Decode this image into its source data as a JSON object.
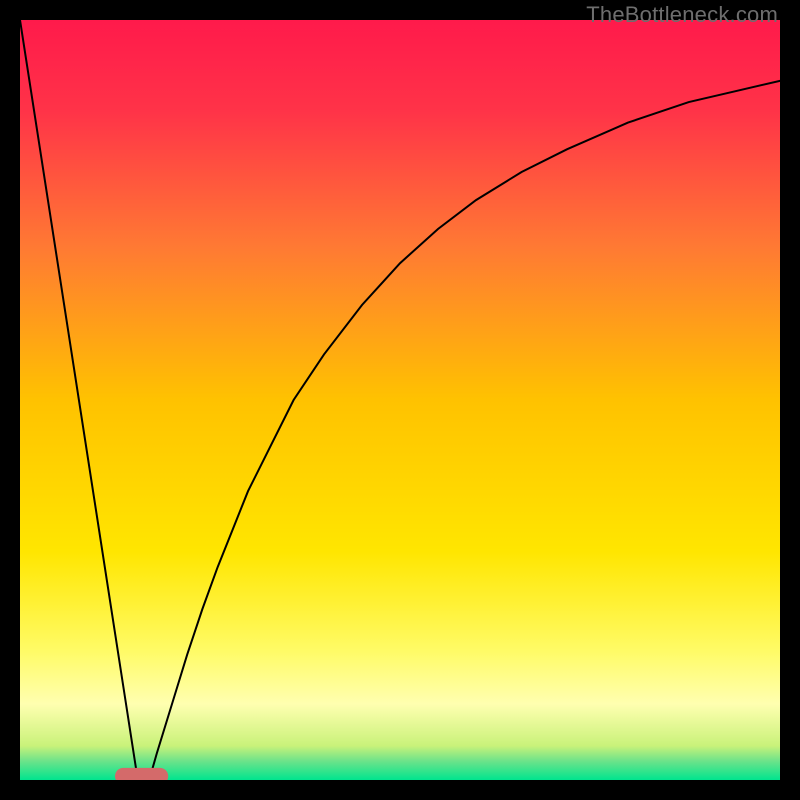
{
  "watermark": "TheBottleneck.com",
  "chart_data": {
    "type": "line",
    "title": "",
    "xlabel": "",
    "ylabel": "",
    "xlim": [
      0,
      100
    ],
    "ylim": [
      0,
      100
    ],
    "background_gradient": {
      "stops": [
        {
          "offset": 0.0,
          "color": "#ff1a4b"
        },
        {
          "offset": 0.12,
          "color": "#ff3348"
        },
        {
          "offset": 0.3,
          "color": "#ff7a33"
        },
        {
          "offset": 0.5,
          "color": "#ffc200"
        },
        {
          "offset": 0.7,
          "color": "#ffe600"
        },
        {
          "offset": 0.83,
          "color": "#fffb66"
        },
        {
          "offset": 0.9,
          "color": "#ffffb0"
        },
        {
          "offset": 0.955,
          "color": "#c9f27a"
        },
        {
          "offset": 0.975,
          "color": "#6de38a"
        },
        {
          "offset": 1.0,
          "color": "#00e48e"
        }
      ]
    },
    "marker": {
      "x": 16,
      "y": 0.5,
      "width": 7,
      "height": 2.2,
      "rx": 1.1,
      "color": "#d46a6a"
    },
    "series": [
      {
        "name": "left-line",
        "stroke": "#000000",
        "stroke_width": 2,
        "x": [
          0,
          15.5
        ],
        "values": [
          100,
          0
        ]
      },
      {
        "name": "right-curve",
        "stroke": "#000000",
        "stroke_width": 2,
        "x": [
          17,
          18,
          20,
          22,
          24,
          26,
          28,
          30,
          33,
          36,
          40,
          45,
          50,
          55,
          60,
          66,
          72,
          80,
          88,
          94,
          100
        ],
        "values": [
          0,
          3.5,
          10,
          16.5,
          22.5,
          28,
          33,
          38,
          44,
          50,
          56,
          62.5,
          68,
          72.5,
          76.3,
          80,
          83,
          86.5,
          89.2,
          90.6,
          92
        ]
      }
    ]
  }
}
